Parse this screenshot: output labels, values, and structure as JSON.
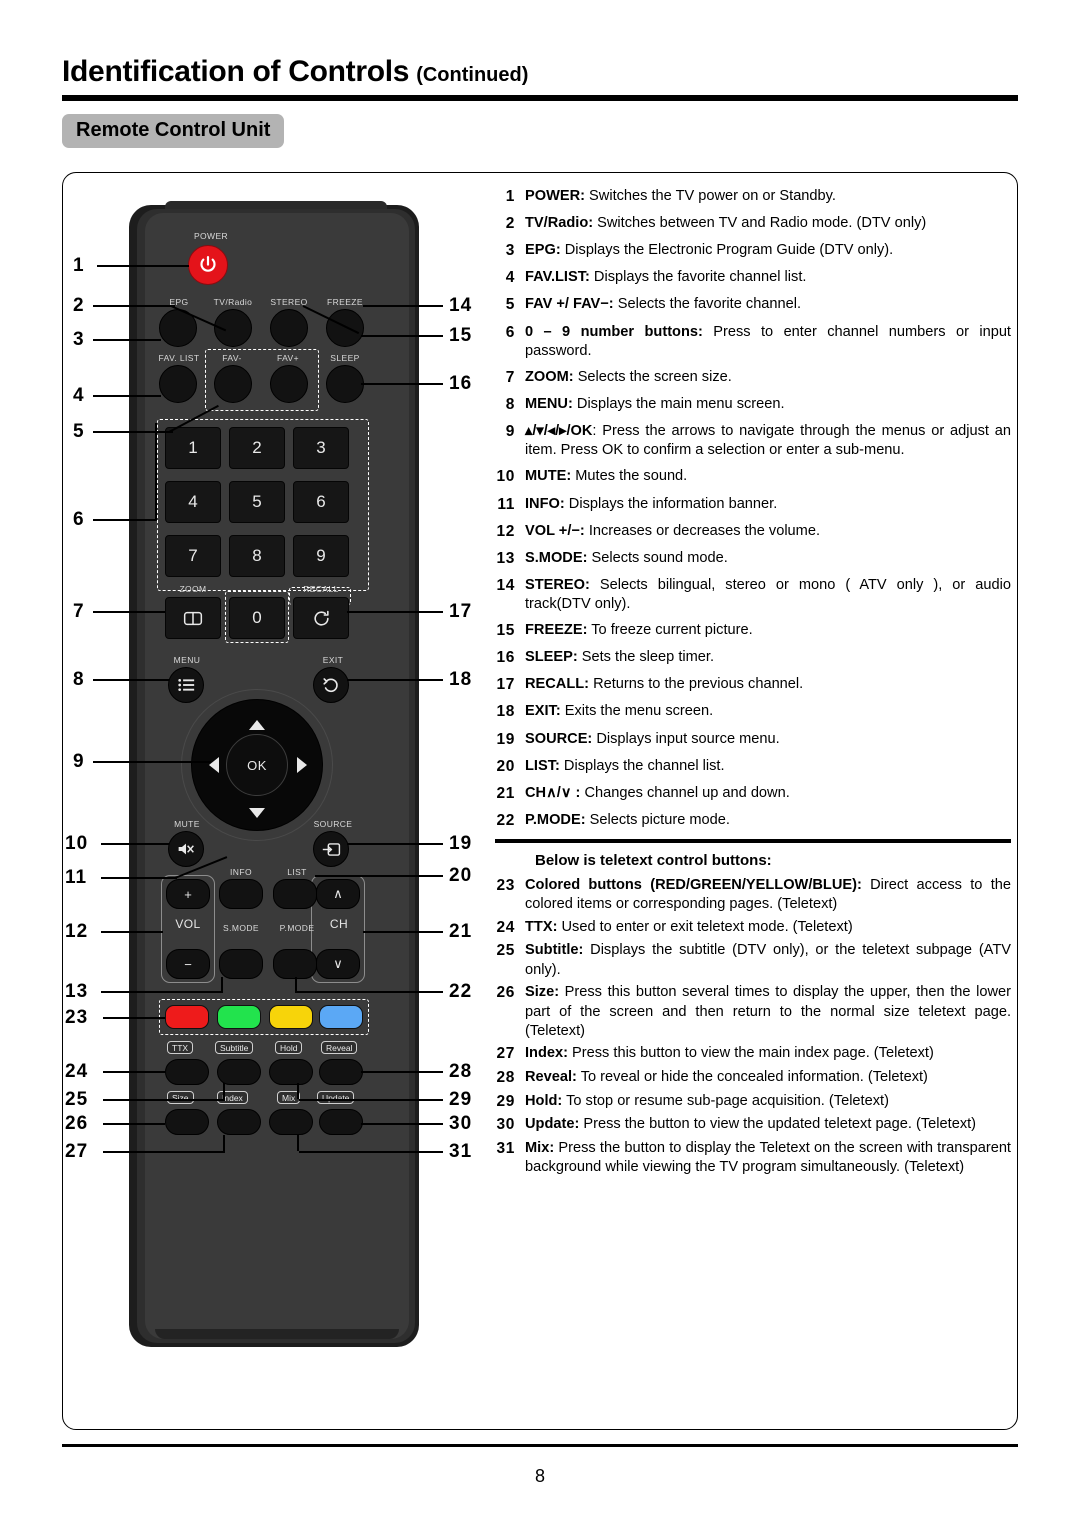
{
  "header": {
    "title_main": "Identification of Controls",
    "title_continued": "(Continued)",
    "section": "Remote Control Unit"
  },
  "footer": {
    "page_number": "8"
  },
  "remote": {
    "labels": {
      "power": "POWER",
      "epg": "EPG",
      "tv_radio": "TV/Radio",
      "stereo": "STEREO",
      "freeze": "FREEZE",
      "fav_list": "FAV. LIST",
      "fav_minus": "FAV-",
      "fav_plus": "FAV+",
      "sleep": "SLEEP",
      "zoom": "ZOOM",
      "recall": "RECALL",
      "menu": "MENU",
      "exit": "EXIT",
      "mute": "MUTE",
      "source": "SOURCE",
      "ok": "OK",
      "info": "INFO",
      "list": "LIST",
      "s_mode": "S.MODE",
      "p_mode": "P.MODE",
      "vol": "VOL",
      "vol_plus": "+",
      "vol_minus": "−",
      "ch": "CH",
      "ch_up": "∧",
      "ch_down": "∨"
    },
    "numeric_keys": [
      "1",
      "2",
      "3",
      "4",
      "5",
      "6",
      "7",
      "8",
      "9",
      "0"
    ],
    "teletext_labels": [
      "TTX",
      "Subtitle",
      "Hold",
      "Reveal",
      "Size",
      "Index",
      "Mix",
      "Update"
    ],
    "color_buttons": [
      {
        "name": "red",
        "color": "#ee1b1b"
      },
      {
        "name": "green",
        "color": "#22e34d"
      },
      {
        "name": "yellow",
        "color": "#f7d40a"
      },
      {
        "name": "blue",
        "color": "#5ba8f5"
      }
    ],
    "power_button_color": "#e4131a",
    "callouts_left": [
      "1",
      "2",
      "3",
      "4",
      "5",
      "6",
      "7",
      "8",
      "9",
      "10",
      "11",
      "12",
      "13",
      "23",
      "24",
      "25",
      "26",
      "27"
    ],
    "callouts_right": [
      "14",
      "15",
      "16",
      "17",
      "18",
      "19",
      "20",
      "21",
      "22",
      "28",
      "29",
      "30",
      "31"
    ]
  },
  "descriptions": {
    "teletext_heading": "Below is teletext control buttons:",
    "items": [
      {
        "n": "1",
        "bold": "POWER:",
        "rest": " Switches the TV power on or Standby."
      },
      {
        "n": "2",
        "bold": "TV/Radio:",
        "rest": " Switches between TV and Radio mode. (DTV only)"
      },
      {
        "n": "3",
        "bold": "EPG:",
        "rest": " Displays the Electronic Program Guide (DTV only)."
      },
      {
        "n": "4",
        "bold": "FAV.LIST:",
        "rest": " Displays the favorite channel list."
      },
      {
        "n": "5",
        "bold": "FAV +/ FAV−:",
        "rest": " Selects the favorite channel."
      },
      {
        "n": "6",
        "bold": "0 – 9 number buttons:",
        "rest": " Press to enter channel numbers or input password."
      },
      {
        "n": "7",
        "bold": "ZOOM:",
        "rest": " Selects the screen size."
      },
      {
        "n": "8",
        "bold": "MENU:",
        "rest": " Displays the main menu screen."
      },
      {
        "n": "9",
        "bold": "▴/▾/◂/▸/OK",
        "rest": ": Press the arrows to navigate through the menus or adjust an item. Press OK to confirm a selection or enter a sub-menu."
      },
      {
        "n": "10",
        "bold": "MUTE:",
        "rest": " Mutes the sound."
      },
      {
        "n": "11",
        "bold": "INFO:",
        "rest": " Displays the information banner."
      },
      {
        "n": "12",
        "bold": "VOL +/−:",
        "rest": " Increases or decreases the volume."
      },
      {
        "n": "13",
        "bold": "S.MODE:",
        "rest": " Selects sound mode."
      },
      {
        "n": "14",
        "bold": "STEREO:",
        "rest": " Selects bilingual, stereo or mono ( ATV only ), or audio track(DTV only)."
      },
      {
        "n": "15",
        "bold": "FREEZE:",
        "rest": " To freeze current picture."
      },
      {
        "n": "16",
        "bold": "SLEEP:",
        "rest": " Sets the sleep timer."
      },
      {
        "n": "17",
        "bold": "RECALL:",
        "rest": " Returns to the previous channel."
      },
      {
        "n": "18",
        "bold": "EXIT:",
        "rest": " Exits the menu screen."
      },
      {
        "n": "19",
        "bold": "SOURCE:",
        "rest": " Displays input source menu."
      },
      {
        "n": "20",
        "bold": "LIST:",
        "rest": " Displays the channel list."
      },
      {
        "n": "21",
        "bold": "CH∧/∨ :",
        "rest": " Changes channel up and down."
      },
      {
        "n": "22",
        "bold": "P.MODE:",
        "rest": " Selects picture mode."
      }
    ],
    "teletext_items": [
      {
        "n": "23",
        "bold": "Colored buttons (RED/GREEN/YELLOW/BLUE):",
        "rest": " Direct access to the colored items or corresponding pages. (Teletext)"
      },
      {
        "n": "24",
        "bold": "TTX:",
        "rest": " Used to enter or exit teletext mode. (Teletext)"
      },
      {
        "n": "25",
        "bold": "Subtitle:",
        "rest": " Displays the subtitle (DTV only), or the teletext subpage (ATV only)."
      },
      {
        "n": "26",
        "bold": "Size:",
        "rest": " Press this button several times to display the upper, then the lower part of the screen and then return to the normal size teletext page. (Teletext)"
      },
      {
        "n": "27",
        "bold": "Index:",
        "rest": " Press this button to view the main index page. (Teletext)"
      },
      {
        "n": "28",
        "bold": "Reveal:",
        "rest": " To reveal or hide the concealed information. (Teletext)"
      },
      {
        "n": "29",
        "bold": "Hold:",
        "rest": " To stop or resume sub-page acquisition. (Teletext)"
      },
      {
        "n": "30",
        "bold": "Update:",
        "rest": " Press the button to view the updated teletext page. (Teletext)"
      },
      {
        "n": "31",
        "bold": "Mix:",
        "rest": " Press the button to display the Teletext on the screen with transparent background while viewing the TV program simultaneously. (Teletext)"
      }
    ]
  }
}
